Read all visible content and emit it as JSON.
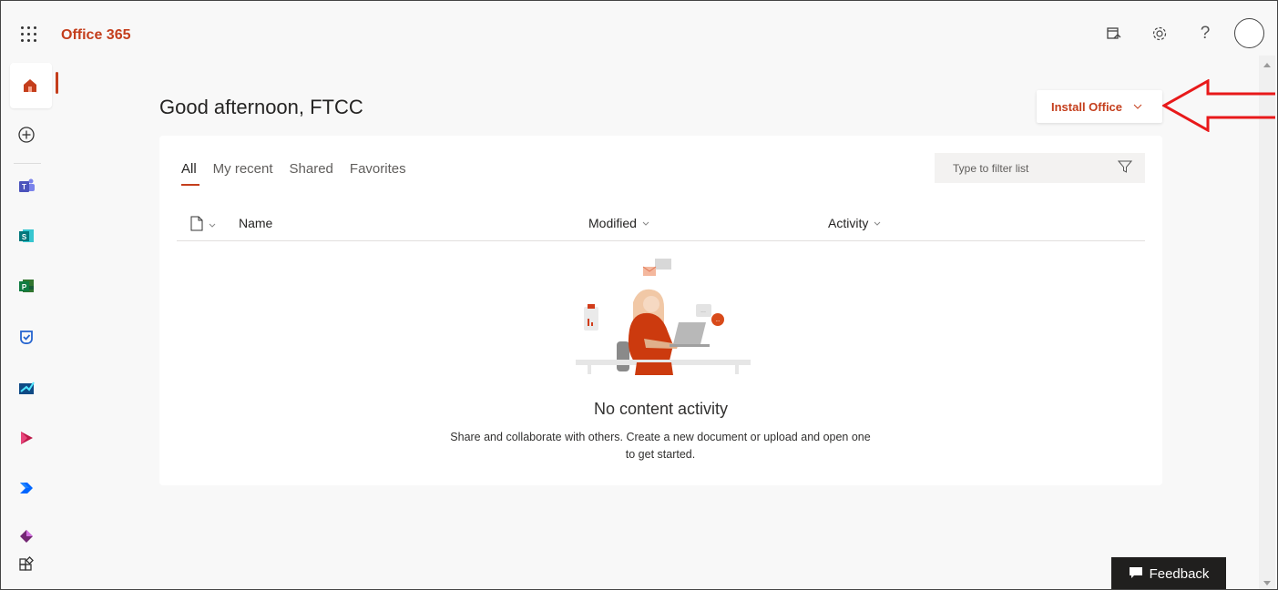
{
  "app": {
    "title": "Office 365"
  },
  "topbar": {
    "icons": [
      "waffle-icon",
      "my-day-icon",
      "settings-icon",
      "help-icon",
      "avatar"
    ],
    "help_glyph": "?"
  },
  "rail": {
    "items": [
      "home-icon",
      "create-icon",
      "teams-icon",
      "sway-icon",
      "project-icon",
      "todo-icon",
      "kaizala-icon",
      "stream-icon",
      "power-automate-icon",
      "power-apps-icon",
      "all-apps-icon"
    ]
  },
  "main": {
    "greeting": "Good afternoon, FTCC",
    "install_button": {
      "label": "Install Office"
    },
    "tabs": [
      {
        "label": "All",
        "active": true
      },
      {
        "label": "My recent",
        "active": false
      },
      {
        "label": "Shared",
        "active": false
      },
      {
        "label": "Favorites",
        "active": false
      }
    ],
    "filter": {
      "placeholder": "Type to filter list"
    },
    "columns": {
      "name": "Name",
      "modified": "Modified",
      "activity": "Activity"
    },
    "empty": {
      "title": "No content activity",
      "description_line1": "Share and collaborate with others. Create a new document or upload and open one",
      "description_line2": "to get started."
    }
  },
  "feedback": {
    "label": "Feedback"
  },
  "colors": {
    "accent": "#c43e1c",
    "annotation_arrow": "#e8191a"
  }
}
